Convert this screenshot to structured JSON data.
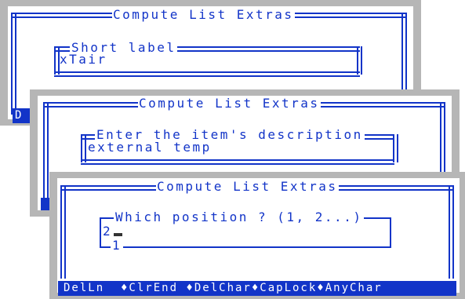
{
  "windows": [
    {
      "title": "Compute List Extras",
      "field_label": "Short label",
      "field_value": "xTair",
      "status_visible": "D"
    },
    {
      "title": "Compute List Extras",
      "field_label": "Enter the item's description",
      "field_value": "external temp"
    },
    {
      "title": "Compute List Extras",
      "field_label": "Which position ? (1, 2...)",
      "field_value": "2",
      "field_hint": "1",
      "status_bar": "DelLn  ♦ClrEnd ♦DelChar♦CapLock♦AnyChar"
    }
  ],
  "colors": {
    "border": "#1234c8",
    "frame": "#b6b6b6",
    "background": "#ffffff",
    "cursor": "#333333"
  }
}
